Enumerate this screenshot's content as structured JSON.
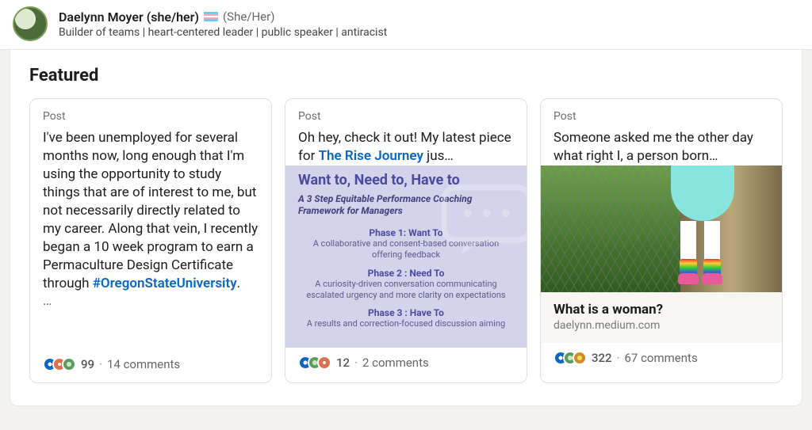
{
  "profile": {
    "name": "Daelynn Moyer (she/her)",
    "pronouns_display": "(She/Her)",
    "headline": "Builder of teams | heart-centered leader | public speaker | antiracist"
  },
  "section_title": "Featured",
  "posts": [
    {
      "type_label": "Post",
      "body_pre": "I've been unemployed for several months now, long enough that I'm using the opportunity to study things that are of interest to me, but not necessarily directly related to my career. Along that vein, I recently began a 10 week program to earn a Permaculture Design Certificate through ",
      "body_link": "#OregonStateUniversity",
      "body_post": ".",
      "truncation": "…",
      "reactions_count": "99",
      "comments_text": "14 comments"
    },
    {
      "type_label": "Post",
      "body_pre": "Oh hey, check it out! My latest piece for ",
      "body_link": "The Rise Journey",
      "body_post": " jus…",
      "graphic": {
        "title_fragment": "Want to, Need to, Have to",
        "subtitle": "A 3 Step Equitable Performance Coaching Framework for Managers",
        "phase1_title": "Phase 1: Want To",
        "phase1_desc": "A collaborative and consent-based conversation offering feedback",
        "phase2_title": "Phase 2 : Need To",
        "phase2_desc": "A curiosity-driven conversation communicating escalated urgency and more clarity on expectations",
        "phase3_title": "Phase 3 : Have To",
        "phase3_desc": "A results and correction-focused discussion aiming"
      },
      "reactions_count": "12",
      "comments_text": "2 comments"
    },
    {
      "type_label": "Post",
      "body_pre": "Someone asked me the other day what right I, a person born…",
      "link_preview": {
        "title": "What is a woman?",
        "domain": "daelynn.medium.com"
      },
      "reactions_count": "322",
      "comments_text": "67 comments"
    }
  ]
}
